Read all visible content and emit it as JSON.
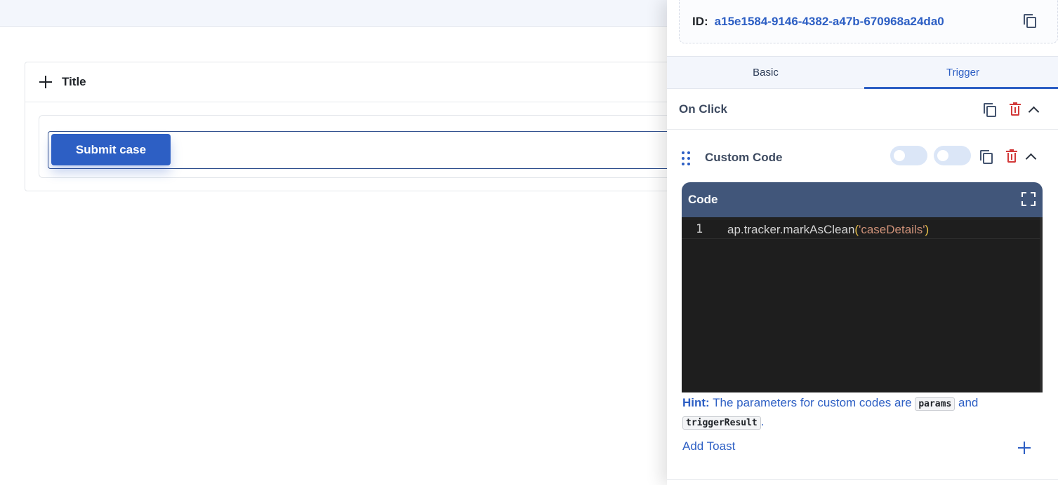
{
  "canvas": {
    "card": {
      "title": "Title"
    },
    "submit_button": {
      "label": "Submit case"
    }
  },
  "drawer": {
    "id_label": "ID:",
    "id_value": "a15e1584-9146-4382-a47b-670968a24da0",
    "tabs": [
      {
        "label": "Basic",
        "active": false
      },
      {
        "label": "Trigger",
        "active": true
      }
    ],
    "trigger_event": {
      "title": "On Click"
    },
    "action": {
      "title": "Custom Code",
      "toggles": [
        {
          "on": false
        },
        {
          "on": false
        }
      ]
    },
    "code_panel": {
      "title": "Code",
      "lines": [
        {
          "number": "1",
          "object": "ap.tracker.markAsClean",
          "open_paren": "(",
          "argument": "'caseDetails'",
          "close_paren": ")"
        }
      ]
    },
    "hint": {
      "label": "Hint:",
      "text_before": " The parameters for custom codes are ",
      "param1": "params",
      "text_mid": " and ",
      "param2": "triggerResult",
      "text_after": "."
    },
    "add_toast": {
      "label": "Add Toast"
    }
  },
  "colors": {
    "accent": "#2d5fc4",
    "danger": "#d33a3a",
    "code_header": "#41567a",
    "editor_bg": "#1e1e1e"
  }
}
